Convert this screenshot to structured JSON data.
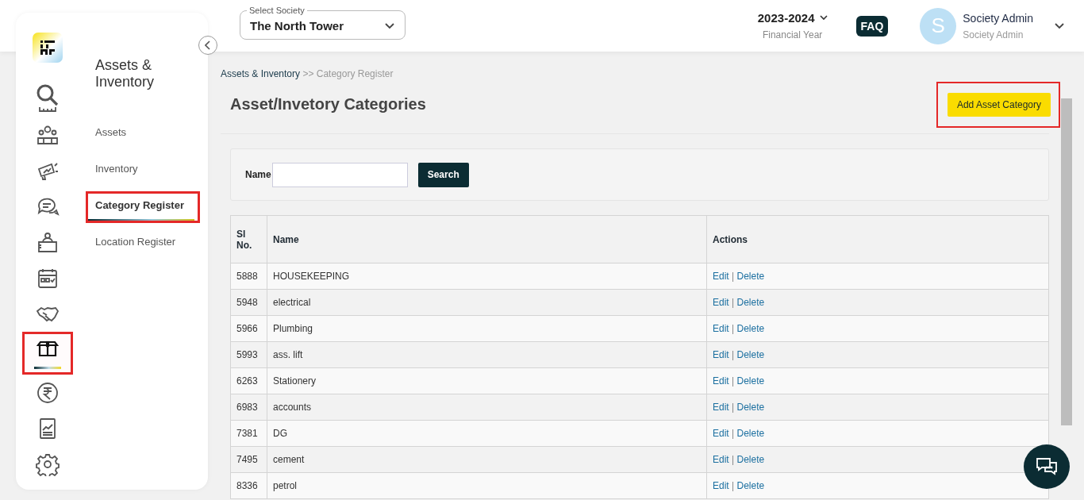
{
  "rail": {
    "items": [
      {
        "selected": false
      },
      {
        "selected": false
      },
      {
        "selected": false
      },
      {
        "selected": false
      },
      {
        "selected": false
      },
      {
        "selected": false
      },
      {
        "selected": false
      },
      {
        "selected": false
      },
      {
        "selected": true,
        "highlighted": true
      },
      {
        "selected": false
      },
      {
        "selected": false
      },
      {
        "selected": false
      }
    ]
  },
  "submenu": {
    "title": "Assets & Inventory",
    "items": [
      {
        "label": "Assets",
        "selected": false,
        "highlighted": false
      },
      {
        "label": "Inventory",
        "selected": false,
        "highlighted": false
      },
      {
        "label": "Category Register",
        "selected": true,
        "highlighted": true
      },
      {
        "label": "Location Register",
        "selected": false,
        "highlighted": false
      }
    ]
  },
  "header": {
    "society": {
      "label": "Select Society",
      "value": "The North Tower"
    },
    "year": {
      "value": "2023-2024",
      "label": "Financial Year"
    },
    "faq": "FAQ",
    "user": {
      "initial": "S",
      "name": "Society Admin",
      "role": "Society Admin"
    }
  },
  "breadcrumb": {
    "parent": "Assets & Inventory",
    "separator": ">>",
    "current": "Category Register"
  },
  "page_title": "Asset/Invetory Categories",
  "add_button": {
    "label": "Add Asset Category",
    "highlighted": true
  },
  "search": {
    "label": "Name",
    "button": "Search"
  },
  "table": {
    "columns": [
      "Sl No.",
      "Name",
      "Actions"
    ],
    "rows": [
      {
        "sl": "5888",
        "name": "HOUSEKEEPING",
        "edit": "Edit",
        "sep": "|",
        "delete": "Delete"
      },
      {
        "sl": "5948",
        "name": "electrical",
        "edit": "Edit",
        "sep": "|",
        "delete": "Delete"
      },
      {
        "sl": "5966",
        "name": "Plumbing",
        "edit": "Edit",
        "sep": "|",
        "delete": "Delete"
      },
      {
        "sl": "5993",
        "name": "ass. lift",
        "edit": "Edit",
        "sep": "|",
        "delete": "Delete"
      },
      {
        "sl": "6263",
        "name": "Stationery",
        "edit": "Edit",
        "sep": "|",
        "delete": "Delete"
      },
      {
        "sl": "6983",
        "name": "accounts",
        "edit": "Edit",
        "sep": "|",
        "delete": "Delete"
      },
      {
        "sl": "7381",
        "name": "DG",
        "edit": "Edit",
        "sep": "|",
        "delete": "Delete"
      },
      {
        "sl": "7495",
        "name": "cement",
        "edit": "Edit",
        "sep": "|",
        "delete": "Delete"
      },
      {
        "sl": "8336",
        "name": "petrol",
        "edit": "Edit",
        "sep": "|",
        "delete": "Delete"
      }
    ]
  }
}
